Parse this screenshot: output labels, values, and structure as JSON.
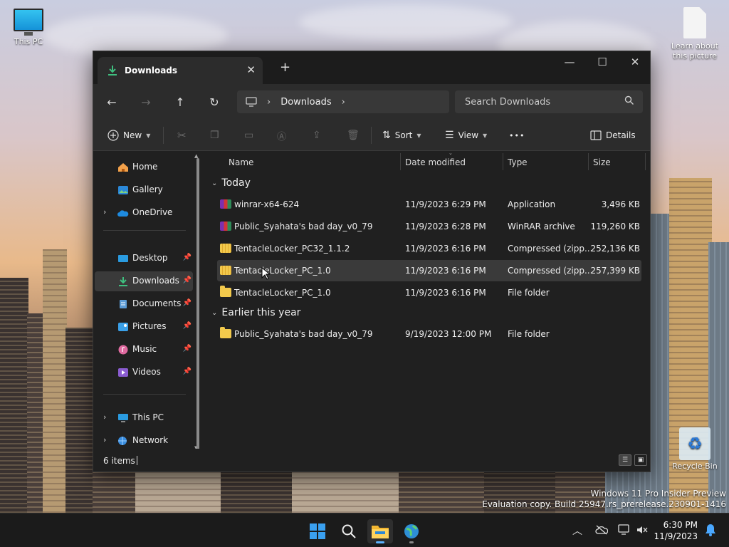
{
  "desktop": {
    "this_pc_label": "This PC",
    "learn_label": "Learn about this picture",
    "recycle_label": "Recycle Bin",
    "watermark_line1": "Windows 11 Pro Insider Preview",
    "watermark_line2": "Evaluation copy. Build 25947.rs_prerelease.230901-1416"
  },
  "window": {
    "tab_title": "Downloads",
    "new_tab": "+",
    "close_tab": "✕",
    "minimize": "—",
    "maximize": "☐",
    "close": "✕"
  },
  "navbar": {
    "back": "←",
    "forward": "→",
    "up": "↑",
    "refresh": "↻",
    "breadcrumb": "Downloads",
    "search_placeholder": "Search Downloads"
  },
  "toolbar": {
    "new_label": "New",
    "sort_label": "Sort",
    "view_label": "View",
    "more_label": "•••",
    "details_label": "Details"
  },
  "sidebar": {
    "items": [
      {
        "label": "Home"
      },
      {
        "label": "Gallery"
      },
      {
        "label": "OneDrive"
      },
      {
        "label": "Desktop"
      },
      {
        "label": "Downloads"
      },
      {
        "label": "Documents"
      },
      {
        "label": "Pictures"
      },
      {
        "label": "Music"
      },
      {
        "label": "Videos"
      },
      {
        "label": "This PC"
      },
      {
        "label": "Network"
      }
    ]
  },
  "columns": {
    "name": "Name",
    "date": "Date modified",
    "type": "Type",
    "size": "Size"
  },
  "groups": [
    {
      "label": "Today",
      "rows": [
        {
          "name": "winrar-x64-624",
          "date": "11/9/2023 6:29 PM",
          "type": "Application",
          "size": "3,496 KB",
          "icon": "winrar-app-icon"
        },
        {
          "name": "Public_Syahata's bad day_v0_79",
          "date": "11/9/2023 6:28 PM",
          "type": "WinRAR archive",
          "size": "119,260 KB",
          "icon": "rar-archive-icon"
        },
        {
          "name": "TentacleLocker_PC32_1.1.2",
          "date": "11/9/2023 6:16 PM",
          "type": "Compressed (zipp...",
          "size": "252,136 KB",
          "icon": "zip-folder-icon"
        },
        {
          "name": "TentacleLocker_PC_1.0",
          "date": "11/9/2023 6:16 PM",
          "type": "Compressed (zipp...",
          "size": "257,399 KB",
          "icon": "zip-folder-icon"
        },
        {
          "name": "TentacleLocker_PC_1.0",
          "date": "11/9/2023 6:16 PM",
          "type": "File folder",
          "size": "",
          "icon": "folder-icon"
        }
      ]
    },
    {
      "label": "Earlier this year",
      "rows": [
        {
          "name": "Public_Syahata's bad day_v0_79",
          "date": "9/19/2023 12:00 PM",
          "type": "File folder",
          "size": "",
          "icon": "folder-icon"
        }
      ]
    }
  ],
  "status": {
    "item_count": "6 items"
  },
  "taskbar": {
    "time": "6:30 PM",
    "date": "11/9/2023"
  }
}
